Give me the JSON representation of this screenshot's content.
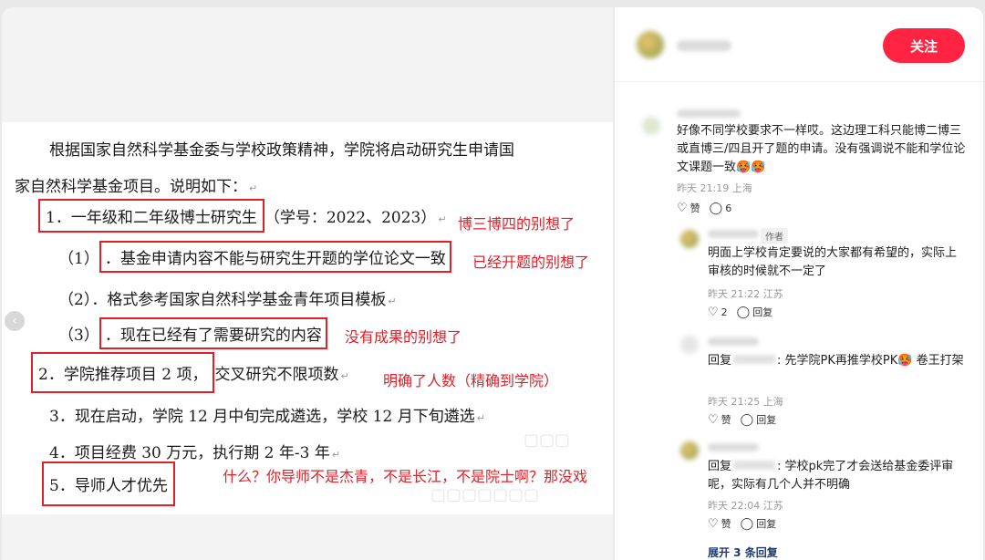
{
  "document": {
    "intro_line1": "根据国家自然科学基金委与学校政策精神，学院将启动研究生申请国",
    "intro_line2": "家自然科学基金项目。说明如下：",
    "item1_boxed": "1．一年级和二年级博士研究生",
    "item1_rest": "（学号：2022、2023）",
    "sub1_prefix": "（1）",
    "sub1_boxed": "．基金申请内容不能与研究生开题的学位论文一致",
    "sub2": "（2）．格式参考国家自然科学基金青年项目模板",
    "sub3_prefix": "（3）",
    "sub3_boxed": "．现在已经有了需要研究的内容",
    "item2_boxed": "2．学院推荐项目 2 项，",
    "item2_rest": "交叉研究不限项数",
    "item3": "3．现在启动，学院 12 月中旬完成遴选，学校 12 月下旬遴选",
    "item4": "4．项目经费 30 万元，执行期 2 年-3 年",
    "item5_boxed": "5．导师人才优先",
    "para_mark": "↵"
  },
  "annotations": {
    "a1": "博三博四的别想了",
    "a2": "已经开题的别想了",
    "a3": "没有成果的别想了",
    "a4": "明确了人数（精确到学院）",
    "a5": "什么？你导师不是杰青，不是长江，不是院士啊？那没戏"
  },
  "header": {
    "follow_label": "关注"
  },
  "comments": [
    {
      "text": "好像不同学校要求不一样哎。这边理工科只能博二博三或直博三/四且开了题的申请。没有强调说不能和学位论文课题一致🥵🥵",
      "time": "昨天 21:19 上海",
      "like_label": "赞",
      "reply_count": "6"
    }
  ],
  "replies": [
    {
      "tag": "作者",
      "text": "明面上学校肯定要说的大家都有希望的，实际上审核的时候就不一定了",
      "time": "昨天 21:22 江苏",
      "like_count": "2",
      "reply_label": "回复"
    },
    {
      "prefix": "回复",
      "text": ": 先学院PK再推学校PK🥵 卷王打架",
      "time": "昨天 21:25 上海",
      "like_label": "赞",
      "reply_label": "回复"
    },
    {
      "prefix": "回复",
      "text": ": 学校pk完了才会送给基金委评审呢，实际有几个人并不明确",
      "time": "昨天 22:04 江苏",
      "like_label": "赞",
      "reply_label": "回复"
    }
  ],
  "expand_label": "展开 3 条回复",
  "colors": {
    "accent": "#ff2442",
    "annotation_red": "#e0202a",
    "link_blue": "#1d3b6e"
  },
  "icons": {
    "heart": "heart-icon",
    "comment": "comment-bubble-icon",
    "prev": "chevron-left-icon"
  }
}
